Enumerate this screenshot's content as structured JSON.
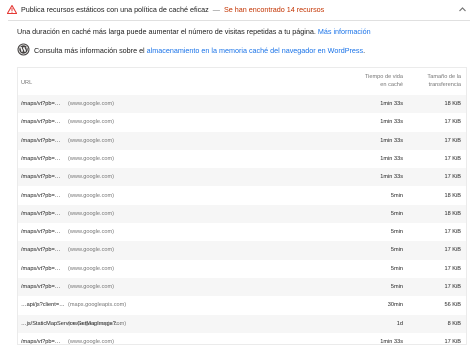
{
  "audit": {
    "title": "Publica recursos estáticos con una política de caché eficaz",
    "separator": "—",
    "status": "Se han encontrado 14 recursos"
  },
  "description": {
    "text": "Una duración en caché más larga puede aumentar el número de visitas repetidas a tu página.",
    "link": "Más información"
  },
  "wordpress": {
    "prefix": "Consulta más información sobre el",
    "link": "almacenamiento en la memoria caché del navegador en WordPress",
    "suffix": "."
  },
  "table": {
    "headers": {
      "url": "URL",
      "ttl_line1": "Tiempo de vida",
      "ttl_line2": "en caché",
      "size_line1": "Tamaño de la",
      "size_line2": "transferencia"
    },
    "rows": [
      {
        "url": "/maps/vt?pb=…",
        "host": "(www.google.com)",
        "ttl": "1min 33s",
        "size": "18 KiB"
      },
      {
        "url": "/maps/vt?pb=…",
        "host": "(www.google.com)",
        "ttl": "1min 33s",
        "size": "17 KiB"
      },
      {
        "url": "/maps/vt?pb=…",
        "host": "(www.google.com)",
        "ttl": "1min 33s",
        "size": "17 KiB"
      },
      {
        "url": "/maps/vt?pb=…",
        "host": "(www.google.com)",
        "ttl": "1min 33s",
        "size": "17 KiB"
      },
      {
        "url": "/maps/vt?pb=…",
        "host": "(www.google.com)",
        "ttl": "1min 33s",
        "size": "17 KiB"
      },
      {
        "url": "/maps/vt?pb=…",
        "host": "(www.google.com)",
        "ttl": "5min",
        "size": "18 KiB"
      },
      {
        "url": "/maps/vt?pb=…",
        "host": "(www.google.com)",
        "ttl": "5min",
        "size": "18 KiB"
      },
      {
        "url": "/maps/vt?pb=…",
        "host": "(www.google.com)",
        "ttl": "5min",
        "size": "17 KiB"
      },
      {
        "url": "/maps/vt?pb=…",
        "host": "(www.google.com)",
        "ttl": "5min",
        "size": "17 KiB"
      },
      {
        "url": "/maps/vt?pb=…",
        "host": "(www.google.com)",
        "ttl": "5min",
        "size": "17 KiB"
      },
      {
        "url": "/maps/vt?pb=…",
        "host": "(www.google.com)",
        "ttl": "5min",
        "size": "17 KiB"
      },
      {
        "url": "…api/js?client=…",
        "host": "(maps.googleapis.com)",
        "ttl": "30min",
        "size": "56 KiB"
      },
      {
        "url": "…js/StaticMapService.GetMapImage?…",
        "host": "(maps.googleapis.com)",
        "ttl": "1d",
        "size": "8 KiB"
      },
      {
        "url": "/maps/vt?pb=…",
        "host": "(www.google.com)",
        "ttl": "1min 33s",
        "size": "17 KiB"
      }
    ]
  },
  "colors": {
    "warning": "#e53935",
    "status": "#c33300",
    "link": "#1a73e8",
    "row_alt": "#f6f6f6"
  },
  "icons": {
    "warning": "warning-triangle-icon",
    "expand": "chevron-up-icon",
    "wordpress": "wordpress-icon"
  }
}
